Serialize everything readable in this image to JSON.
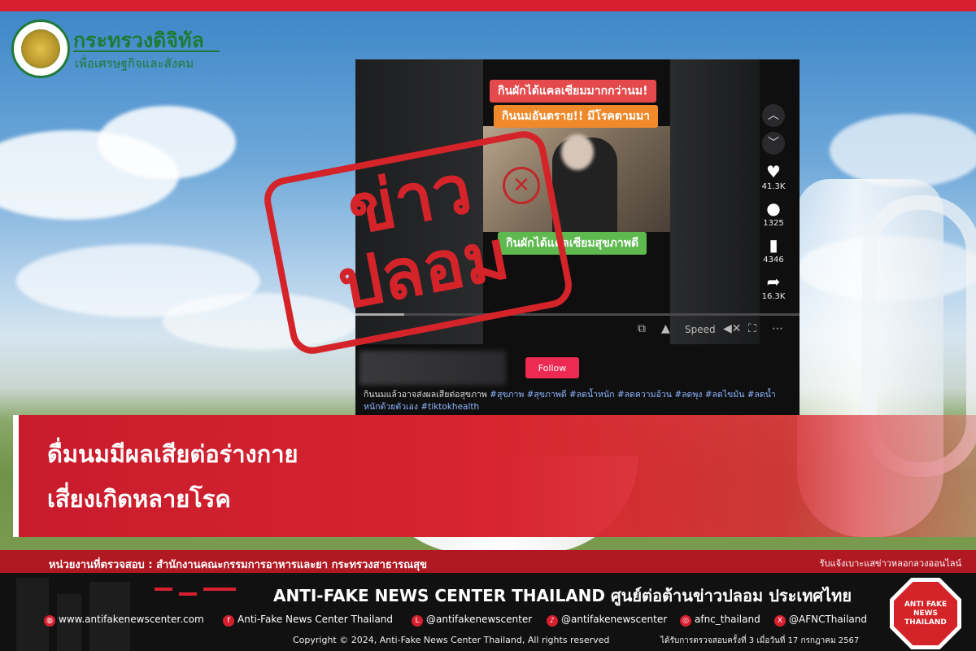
{
  "ministry": {
    "title": "กระทรวงดิจิทัล",
    "subtitle": "เพื่อเศรษฐกิจและสังคม"
  },
  "video": {
    "captions": [
      "กินผักได้แคลเซียมมากกว่านม!",
      "กินนมอันตราย!! มีโรคตามมา",
      "กินผักได้แคลเซียมสุขภาพดี"
    ],
    "side_counts": {
      "likes": "41.3K",
      "comments": "1325",
      "saves": "4346",
      "shares": "16.3K"
    },
    "speed_label": "Speed",
    "follow_label": "Follow",
    "description": "กินนมแล้วอาจส่งผลเสียต่อสุขภาพ",
    "hashtags": "#สุขภาพ #สุขภาพดี #ลดน้ำหนัก #ลดความอ้วน #ลดพุง #ลดไขมัน #ลดน้ำหนักด้วยตัวเอง #tiktokhealth"
  },
  "stamp": {
    "line1": "ข่าว",
    "line2": "ปลอม"
  },
  "headline": {
    "line1": "ดื่มนมมีผลเสียต่อร่างกาย",
    "line2": "เสี่ยงเกิดหลายโรค"
  },
  "agency": {
    "left": "หน่วยงานที่ตรวจสอบ : สำนักงานคณะกรรมการอาหารและยา กระทรวงสาธารณสุข",
    "right": "รับแจ้งเบาะแสข่าวหลอกลวงออนไลน์"
  },
  "footer": {
    "title": "ANTI-FAKE NEWS CENTER THAILAND ศูนย์ต่อต้านข่าวปลอม ประเทศไทย",
    "website": "www.antifakenewscenter.com",
    "facebook": "Anti-Fake News Center Thailand",
    "line": "@antifakenewscenter",
    "tiktok": "@antifakenewscenter",
    "instagram": "afnc_thailand",
    "x": "@AFNCThailand",
    "copyright": "Copyright © 2024, Anti-Fake News Center Thailand, All rights reserved",
    "checked": "ได้รับการตรวจสอบครั้งที่ 3 เมื่อวันที่ 17 กรกฎาคม 2567",
    "badge": "ANTI FAKE NEWS THAILAND"
  },
  "colors": {
    "brand_red": "#d71f2f",
    "ministry_green": "#1f7a37",
    "follow_pink": "#ee2a52"
  }
}
